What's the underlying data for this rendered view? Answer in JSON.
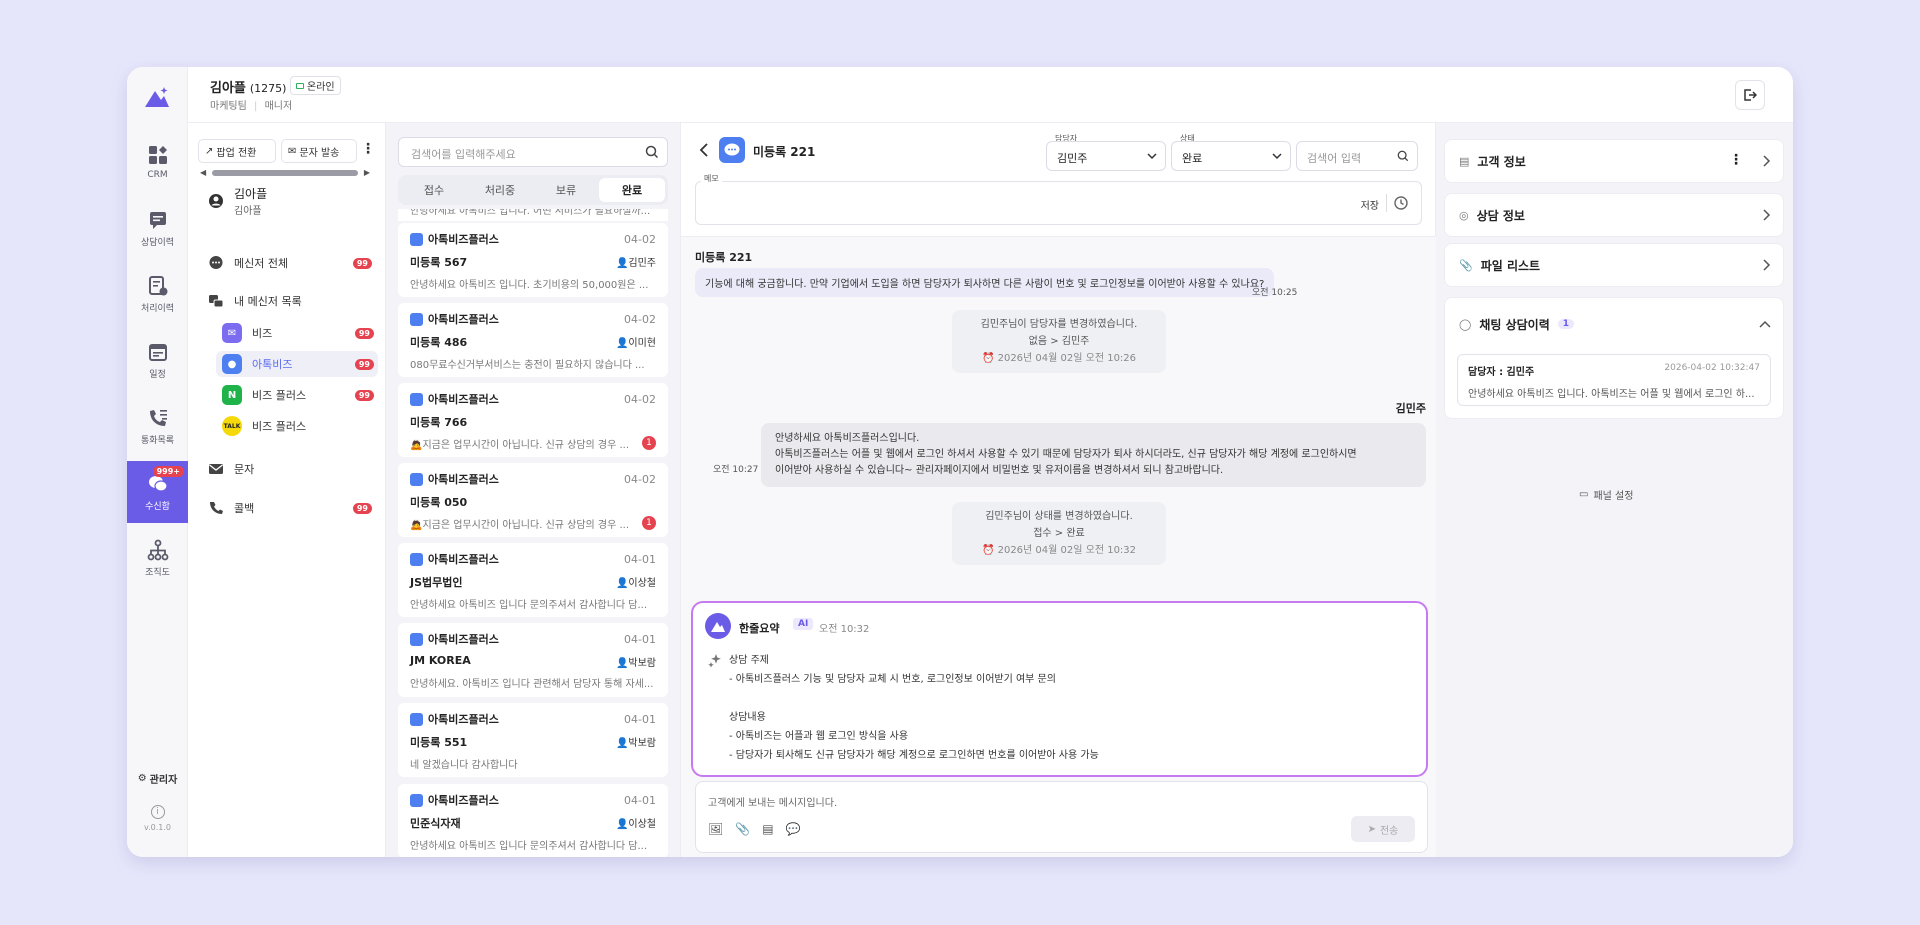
{
  "topbar": {
    "user_name": "김아플",
    "user_count": "(1275)",
    "status": "온라인",
    "team": "마케팅팀",
    "role": "매니저"
  },
  "rail": {
    "items": [
      {
        "label": "CRM",
        "icon": "grid-icon"
      },
      {
        "label": "상담이력",
        "icon": "chat-history-icon"
      },
      {
        "label": "처리이력",
        "icon": "process-history-icon"
      },
      {
        "label": "일정",
        "icon": "calendar-icon"
      },
      {
        "label": "통화목록",
        "icon": "phone-list-icon"
      },
      {
        "label": "수신함",
        "icon": "inbox-icon",
        "badge": "999+"
      },
      {
        "label": "조직도",
        "icon": "org-chart-icon"
      }
    ],
    "admin_label": "관리자",
    "version": "v.0.1.0"
  },
  "sidebar": {
    "popup_button": "팝업 전환",
    "sms_button": "문자 발송",
    "user_name": "김아플",
    "user_sub": "김아플",
    "all_messengers": "메신저 전체",
    "all_badge": "99",
    "my_messengers": "내 메신저 목록",
    "channels": [
      {
        "label": "비즈",
        "badge": "99",
        "color": "#7b6cf0"
      },
      {
        "label": "아톡비즈",
        "badge": "99",
        "color": "#4d7ff0"
      },
      {
        "label": "비즈 플러스",
        "badge": "99",
        "color": "#1fb34a",
        "glyph": "N"
      },
      {
        "label": "비즈 플러스",
        "badge": "",
        "color": "#f5d90a",
        "glyph": "TALK"
      }
    ],
    "sms": "문자",
    "callback": "콜백",
    "callback_badge": "99"
  },
  "list": {
    "search_placeholder": "검색어를 입력해주세요",
    "tabs": [
      "접수",
      "처리중",
      "보류",
      "완료"
    ],
    "active_tab": "완료",
    "partial_preview": "안녕하세요 아톡비즈 입니다. 어떤 서비스가 필요하실까...",
    "cards": [
      {
        "channel": "아톡비즈플러스",
        "date": "04-02",
        "customer": "미등록 567",
        "agent": "김민주",
        "preview": "안녕하세요 아톡비즈 입니다. 초기비용의 50,000원은 ...",
        "unread": ""
      },
      {
        "channel": "아톡비즈플러스",
        "date": "04-02",
        "customer": "미등록 486",
        "agent": "이미현",
        "preview": "080무료수신거부서비스는 충전이 필요하지 않습니다 ...",
        "unread": ""
      },
      {
        "channel": "아톡비즈플러스",
        "date": "04-02",
        "customer": "미등록 766",
        "agent": "",
        "preview": "🙇지금은 업무시간이 아닙니다. 신규 상담의 경우 ...",
        "unread": "1"
      },
      {
        "channel": "아톡비즈플러스",
        "date": "04-02",
        "customer": "미등록 050",
        "agent": "",
        "preview": "🙇지금은 업무시간이 아닙니다. 신규 상담의 경우 ...",
        "unread": "1"
      },
      {
        "channel": "아톡비즈플러스",
        "date": "04-01",
        "customer": "JS법무법인",
        "agent": "이상철",
        "preview": "안녕하세요 아톡비즈 입니다 문의주셔서 감사합니다 담...",
        "unread": ""
      },
      {
        "channel": "아톡비즈플러스",
        "date": "04-01",
        "customer": "JM KOREA",
        "agent": "박보람",
        "preview": "안녕하세요. 아톡비즈 입니다 관련해서 담당자 통해 자세...",
        "unread": ""
      },
      {
        "channel": "아톡비즈플러스",
        "date": "04-01",
        "customer": "미등록 551",
        "agent": "박보람",
        "preview": "네 알겠습니다 감사합니다",
        "unread": ""
      },
      {
        "channel": "아톡비즈플러스",
        "date": "04-01",
        "customer": "민준식자재",
        "agent": "이상철",
        "preview": "안녕하세요 아톡비즈 입니다 문의주셔서 감사합니다 담...",
        "unread": ""
      }
    ]
  },
  "chat": {
    "title": "미등록 221",
    "assignee_label": "담당자",
    "assignee_value": "김민주",
    "status_label": "상태",
    "status_value": "완료",
    "search_placeholder": "검색어 입력",
    "memo_label": "메모",
    "memo_save": "저장",
    "customer_name": "미등록 221",
    "customer_msg": "기능에 대해 궁금합니다. 만약 기업에서 도입을 하면 담당자가 퇴사하면 다른 사람이 번호 및 로그인정보를 이어받아 사용할 수 있나요?",
    "customer_time": "오전 10:25",
    "sys1_line1": "김민주님이 담당자를 변경하였습니다.",
    "sys1_line2": "없음 > 김민주",
    "sys1_ts": "2026년 04월 02일 오전 10:26",
    "agent_name": "김민주",
    "agent_msg_1": "안녕하세요 아톡비즈플러스입니다.",
    "agent_msg_2": "아톡비즈플러스는 어플 및 웹에서 로그인 하셔서 사용할 수 있기 때문에 담당자가 퇴사 하시더라도, 신규 담당자가 해당 계정에 로그인하시면",
    "agent_msg_3": "이어받아 사용하실 수 있습니다~ 관리자페이지에서 비밀번호 및 유저이름을 변경하셔서 되니 참고바랍니다.",
    "agent_time": "오전 10:27",
    "sys2_line1": "김민주님이 상태를 변경하였습니다.",
    "sys2_line2": "접수 > 완료",
    "sys2_ts": "2026년 04월 02일 오전 10:32",
    "ai_title": "한줄요약",
    "ai_badge": "AI",
    "ai_time": "오전 10:32",
    "ai_body": "상담 주제\n- 아톡비즈플러스 기능 및 담당자 교체 시 번호, 로그인정보 이어받기 여부 문의\n\n상담내용\n- 아톡비즈는 어플과 웹 로그인 방식을 사용\n- 담당자가 퇴사해도 신규 담당자가 해당 계정으로 로그인하면 번호를 이어받아 사용 가능",
    "compose_placeholder": "고객에게 보내는 메시지입니다.",
    "send_label": "전송"
  },
  "right": {
    "customer_info": "고객 정보",
    "consult_info": "상담 정보",
    "file_list": "파일 리스트",
    "chat_history": "채팅 상담이력",
    "chat_history_count": "1",
    "history_agent": "담당자 : 김민주",
    "history_date": "2026-04-02 10:32:47",
    "history_preview": "안녕하세요 아톡비즈 입니다. 아톡비즈는 어플 및 웹에서 로그인 하...",
    "panel_settings": "패널 설정"
  }
}
